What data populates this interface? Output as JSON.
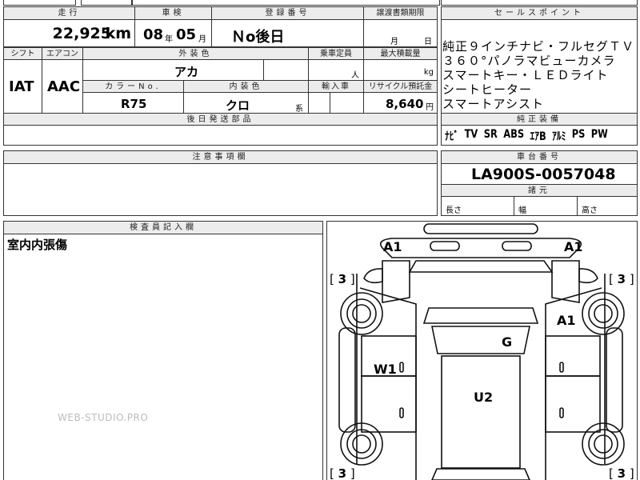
{
  "top": {
    "mileage_label": "走行",
    "mileage_value": "22,925",
    "mileage_unit": "km",
    "inspection_label": "車検",
    "inspection_year": "08",
    "year_unit": "年",
    "inspection_month": "05",
    "month_unit": "月",
    "registration_label": "登録番号",
    "registration_value": "Ｎo後日",
    "transfer_label": "譲渡書類期限",
    "transfer_month_unit": "月",
    "transfer_day_unit": "日"
  },
  "spec": {
    "shift_label": "シフト",
    "shift_value": "IAT",
    "ac_label": "エアコン",
    "ac_value": "AAC",
    "exterior_color_label": "外装色",
    "exterior_color_value": "アカ",
    "capacity_label": "乗車定員",
    "capacity_unit": "人",
    "max_load_label": "最大積載量",
    "max_load_unit": "kg",
    "color_no_label": "カラーNo.",
    "color_no_value": "R75",
    "interior_color_label": "内装色",
    "interior_color_value": "クロ",
    "interior_color_unit": "系",
    "import_label": "輸入車",
    "recycle_label": "リサイクル預託金",
    "recycle_value": "8,640",
    "recycle_unit": "円",
    "later_parts_label": "後日発送部品"
  },
  "sales_points": {
    "label": "セールスポイント",
    "lines": [
      "純正９インチナビ・フルセグＴＶ",
      "３６０°パノラマビューカメラ",
      "スマートキー・ＬＥＤライト",
      "シートヒーター",
      "スマートアシスト"
    ]
  },
  "equipment": {
    "label": "純正装備",
    "items": [
      "ﾅﾋﾞ",
      "TV",
      "SR",
      "ABS",
      "ｴｱB",
      "ｱﾙﾐ",
      "PS",
      "PW"
    ]
  },
  "notes": {
    "label": "注意事項欄"
  },
  "chassis": {
    "label": "車台番号",
    "value": "LA900S-0057048"
  },
  "dimensions": {
    "label": "諸元",
    "length_label": "長さ",
    "width_label": "幅",
    "height_label": "高さ"
  },
  "inspector": {
    "label": "検査員記入欄",
    "note": "室内内張傷",
    "watermark": "WEB-STUDIO.PRO"
  },
  "diagram": {
    "marks": {
      "front_left": "A1",
      "front_right": "A1",
      "right_side": "A1",
      "windshield": "G",
      "left_door": "W1",
      "roof": "U2"
    },
    "tire_tread": {
      "front_left": "3",
      "front_right": "3",
      "rear_left": "3",
      "rear_right": "3"
    }
  }
}
